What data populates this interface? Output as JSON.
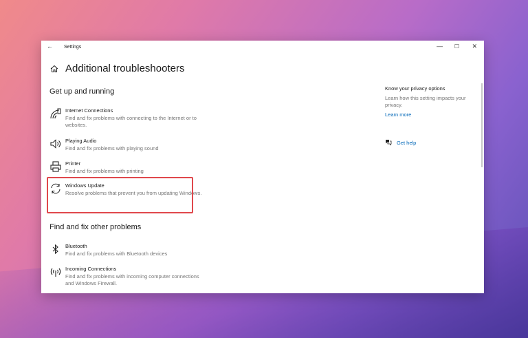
{
  "window": {
    "title": "Settings",
    "back_glyph": "←",
    "min_glyph": "—",
    "max_glyph": "☐",
    "close_glyph": "✕"
  },
  "page": {
    "title": "Additional troubleshooters"
  },
  "sections": [
    {
      "title": "Get up and running"
    },
    {
      "title": "Find and fix other problems"
    }
  ],
  "items": [
    {
      "icon": "internet-connections-icon",
      "name": "Internet Connections",
      "desc": "Find and fix problems with connecting to the Internet or to websites."
    },
    {
      "icon": "speaker-icon",
      "name": "Playing Audio",
      "desc": "Find and fix problems with playing sound"
    },
    {
      "icon": "printer-icon",
      "name": "Printer",
      "desc": "Find and fix problems with printing"
    },
    {
      "icon": "refresh-icon",
      "name": "Windows Update",
      "desc": "Resolve problems that prevent you from updating Windows."
    },
    {
      "icon": "bluetooth-icon",
      "name": "Bluetooth",
      "desc": "Find and fix problems with Bluetooth devices"
    },
    {
      "icon": "incoming-connections-icon",
      "name": "Incoming Connections",
      "desc": "Find and fix problems with incoming computer connections and Windows Firewall."
    }
  ],
  "side": {
    "privacy_title": "Know your privacy options",
    "privacy_desc": "Learn how this setting impacts your privacy.",
    "learn_more": "Learn more",
    "get_help": "Get help"
  },
  "colors": {
    "accent": "#0067b8",
    "highlight": "#e0484c"
  }
}
